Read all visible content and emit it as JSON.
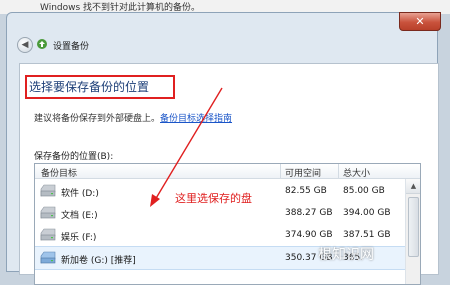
{
  "background_message": "Windows 找不到针对此计算机的备份。",
  "dialog": {
    "close_label": "✕",
    "back_label": "◀",
    "title": "设置备份"
  },
  "heading": "选择要保存备份的位置",
  "advice_text": "建议将备份保存到外部硬盘上。",
  "advice_link": "备份目标选择指南",
  "save_location_label": "保存备份的位置(B):",
  "table": {
    "columns": [
      "备份目标",
      "可用空间",
      "总大小"
    ],
    "rows": [
      {
        "name": "软件 (D:)",
        "free": "82.55 GB",
        "total": "85.00 GB",
        "selected": false
      },
      {
        "name": "文档 (E:)",
        "free": "388.27 GB",
        "total": "394.00 GB",
        "selected": false
      },
      {
        "name": "娱乐 (F:)",
        "free": "374.90 GB",
        "total": "387.51 GB",
        "selected": false
      },
      {
        "name": "新加卷 (G:) [推荐]",
        "free": "350.37 GB",
        "total": "365.",
        "selected": true
      }
    ]
  },
  "annotation": "这里选保存的盘",
  "watermark": "根知识网",
  "colors": {
    "highlight_red": "#e02020",
    "heading_blue": "#1d3f78",
    "link_blue": "#1a55c8"
  }
}
